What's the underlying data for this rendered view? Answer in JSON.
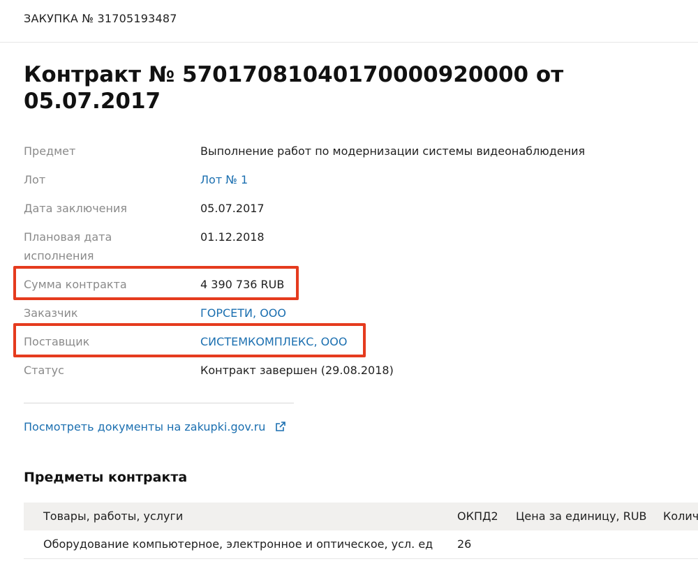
{
  "header": {
    "procurement": "ЗАКУПКА № 31705193487"
  },
  "contract": {
    "title": "Контракт № 57017081040170000920000 от 05.07.2017"
  },
  "fields": {
    "subject_label": "Предмет",
    "subject_value": "Выполнение работ по модернизации системы видеонаблюдения",
    "lot_label": "Лот",
    "lot_value": "Лот № 1",
    "date_label": "Дата заключения",
    "date_value": "05.07.2017",
    "planned_label_1": "Плановая дата",
    "planned_label_2": "исполнения",
    "planned_value": "01.12.2018",
    "amount_label": "Сумма контракта",
    "amount_value": "4 390 736 RUB",
    "customer_label": "Заказчик",
    "customer_value": "ГОРСЕТИ, ООО",
    "supplier_label": "Поставщик",
    "supplier_value": "СИСТЕМКОМПЛЕКС, ООО",
    "status_label": "Статус",
    "status_value": "Контракт завершен (29.08.2018)"
  },
  "docs_link": {
    "label": "Посмотреть документы на zakupki.gov.ru",
    "icon": "external-link-icon"
  },
  "items": {
    "title": "Предметы контракта",
    "columns": [
      "Товары, работы, услуги",
      "ОКПД2",
      "Цена за единицу, RUB",
      "Колич"
    ],
    "rows": [
      [
        "Оборудование компьютерное, электронное и оптическое, усл. ед",
        "26",
        "",
        ""
      ]
    ]
  },
  "colors": {
    "link": "#1b6fb0",
    "highlight": "#e53b1e",
    "label": "#8a8a8a",
    "table_header_bg": "#f1f0ee"
  }
}
